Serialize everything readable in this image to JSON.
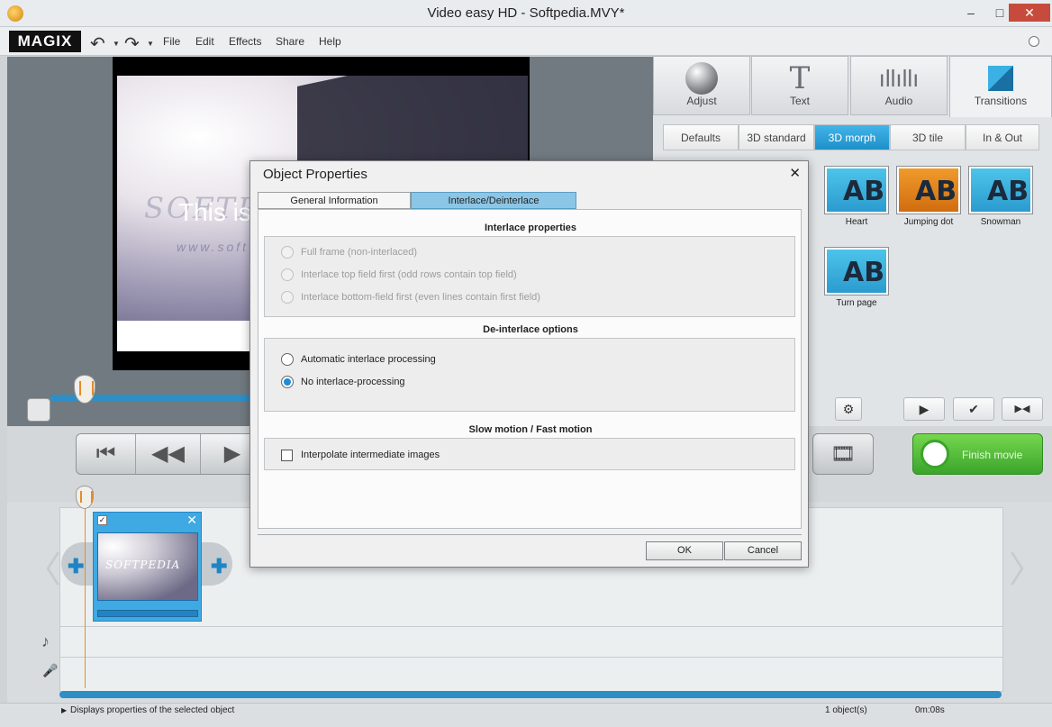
{
  "window": {
    "title": "Video easy HD - Softpedia.MVY*",
    "minimize": "‒",
    "maximize": "□",
    "close": "✕"
  },
  "menubar": {
    "logo": "MAGIX",
    "items": [
      "File",
      "Edit",
      "Effects",
      "Share",
      "Help"
    ]
  },
  "preview": {
    "caption": "This is",
    "watermark": "SOFTPEDIA",
    "url": "www.soft"
  },
  "right_panel": {
    "tabs": [
      {
        "label": "Adjust",
        "icon": "sphere-icon"
      },
      {
        "label": "Text",
        "icon": "text-icon"
      },
      {
        "label": "Audio",
        "icon": "waveform-icon"
      },
      {
        "label": "Transitions",
        "icon": "transitions-icon",
        "active": true
      }
    ],
    "subtabs": [
      "Defaults",
      "3D standard",
      "3D morph",
      "3D tile",
      "In & Out"
    ],
    "active_subtab": "3D morph",
    "thumbnails": [
      {
        "label": "Heart",
        "ab": "AB"
      },
      {
        "label": "Jumping dot",
        "ab": "AB"
      },
      {
        "label": "Snowman",
        "ab": "AB"
      },
      {
        "label": "Turn page",
        "ab": "AB"
      }
    ],
    "controls": {
      "gear": "⚙",
      "play": "▶",
      "apply": "✔",
      "mirror": "▶◀"
    }
  },
  "transport": {
    "to_start": "⏮",
    "rewind": "◀◀",
    "play": "▶",
    "add_media": "🎞",
    "finish_label": "Finish movie"
  },
  "statusbar": {
    "message": "Displays properties of the selected object",
    "count": "1 object(s)",
    "time": "0m:08s"
  },
  "dialog": {
    "title": "Object Properties",
    "close": "✕",
    "tabs": [
      "General Information",
      "Interlace/Deinterlace"
    ],
    "active_tab": "Interlace/Deinterlace",
    "interlace": {
      "title": "Interlace properties",
      "options": [
        "Full frame (non-interlaced)",
        "Interlace top field first (odd rows contain top field)",
        "Interlace bottom-field first (even lines contain first field)"
      ]
    },
    "deinterlace": {
      "title": "De-interlace options",
      "options": [
        "Automatic interlace processing",
        "No interlace-processing"
      ],
      "selected": "No interlace-processing"
    },
    "slowmotion": {
      "title": "Slow motion / Fast motion",
      "checkbox": "Interpolate intermediate images",
      "checked": false
    },
    "ok": "OK",
    "cancel": "Cancel",
    "watermark": "SOFTPEDIA"
  },
  "colors": {
    "accent": "#2e8ec6",
    "finish": "#3aa52b",
    "playhead": "#e88d2a"
  }
}
